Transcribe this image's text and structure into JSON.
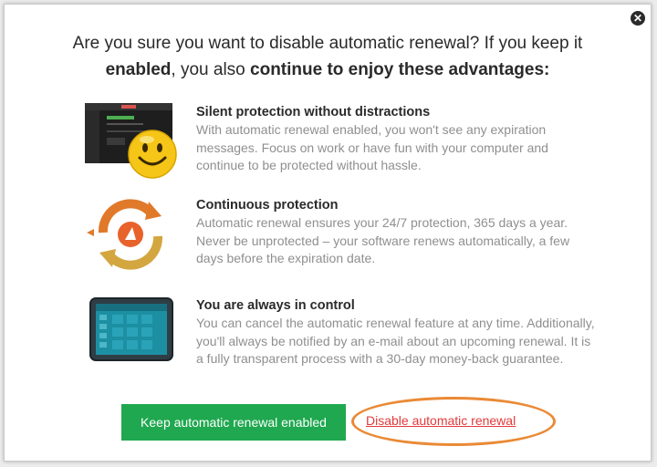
{
  "dialog": {
    "close_icon": "close-icon",
    "headline": {
      "part1": "Are you sure you want to disable automatic renewal? If you keep it",
      "part2_bold": "enabled",
      "part3": ", you also ",
      "part4_bold": "continue to enjoy these advantages:"
    },
    "features": [
      {
        "icon": "dashboard-smiley-icon",
        "title": "Silent protection without distractions",
        "description": "With automatic renewal enabled, you won't see any expiration messages. Focus on work or have fun with your computer and continue to be protected without hassle."
      },
      {
        "icon": "renewal-cycle-icon",
        "title": "Continuous protection",
        "description": "Automatic renewal ensures your 24/7 protection, 365 days a year. Never be unprotected – your software renews automatically, a few days before the expiration date."
      },
      {
        "icon": "control-panel-tablet-icon",
        "title": "You are always in control",
        "description": "You can cancel the automatic renewal feature at any time. Additionally, you'll always be notified by an e-mail about an upcoming renewal. It is a fully transparent process with a 30-day money-back guarantee."
      }
    ],
    "keep_button_label": "Keep automatic renewal enabled",
    "disable_link_label": "Disable automatic renewal",
    "colors": {
      "keep_button": "#1fa84f",
      "disable_link": "#e23a3a",
      "highlight_oval": "#ea8a35"
    }
  }
}
